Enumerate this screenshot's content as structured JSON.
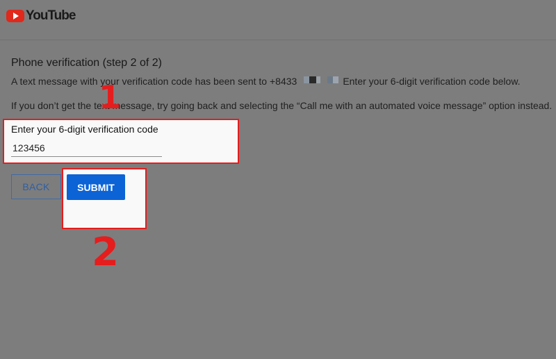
{
  "header": {
    "logo_text": "YouTube",
    "logo_icon": "youtube-play-icon",
    "logo_color": "#e0281b"
  },
  "page": {
    "title": "Phone verification (step 2 of 2)",
    "sent_prefix": "A text message with your verification code has been sent to +8433",
    "sent_suffix": "Enter your 6-digit verification code below.",
    "fallback_text": "If you don’t get the text message, try going back and selecting the “Call me with an automated voice message” option instead."
  },
  "code_field": {
    "label": "Enter your 6-digit verification code",
    "value": "123456"
  },
  "buttons": {
    "back_label": "BACK",
    "submit_label": "SUBMIT"
  },
  "annotations": {
    "step1": "1",
    "step2": "2",
    "highlight_color": "#e51d1d"
  },
  "colors": {
    "submit_bg": "#0b63d6",
    "back_text": "#2f5fa2"
  }
}
